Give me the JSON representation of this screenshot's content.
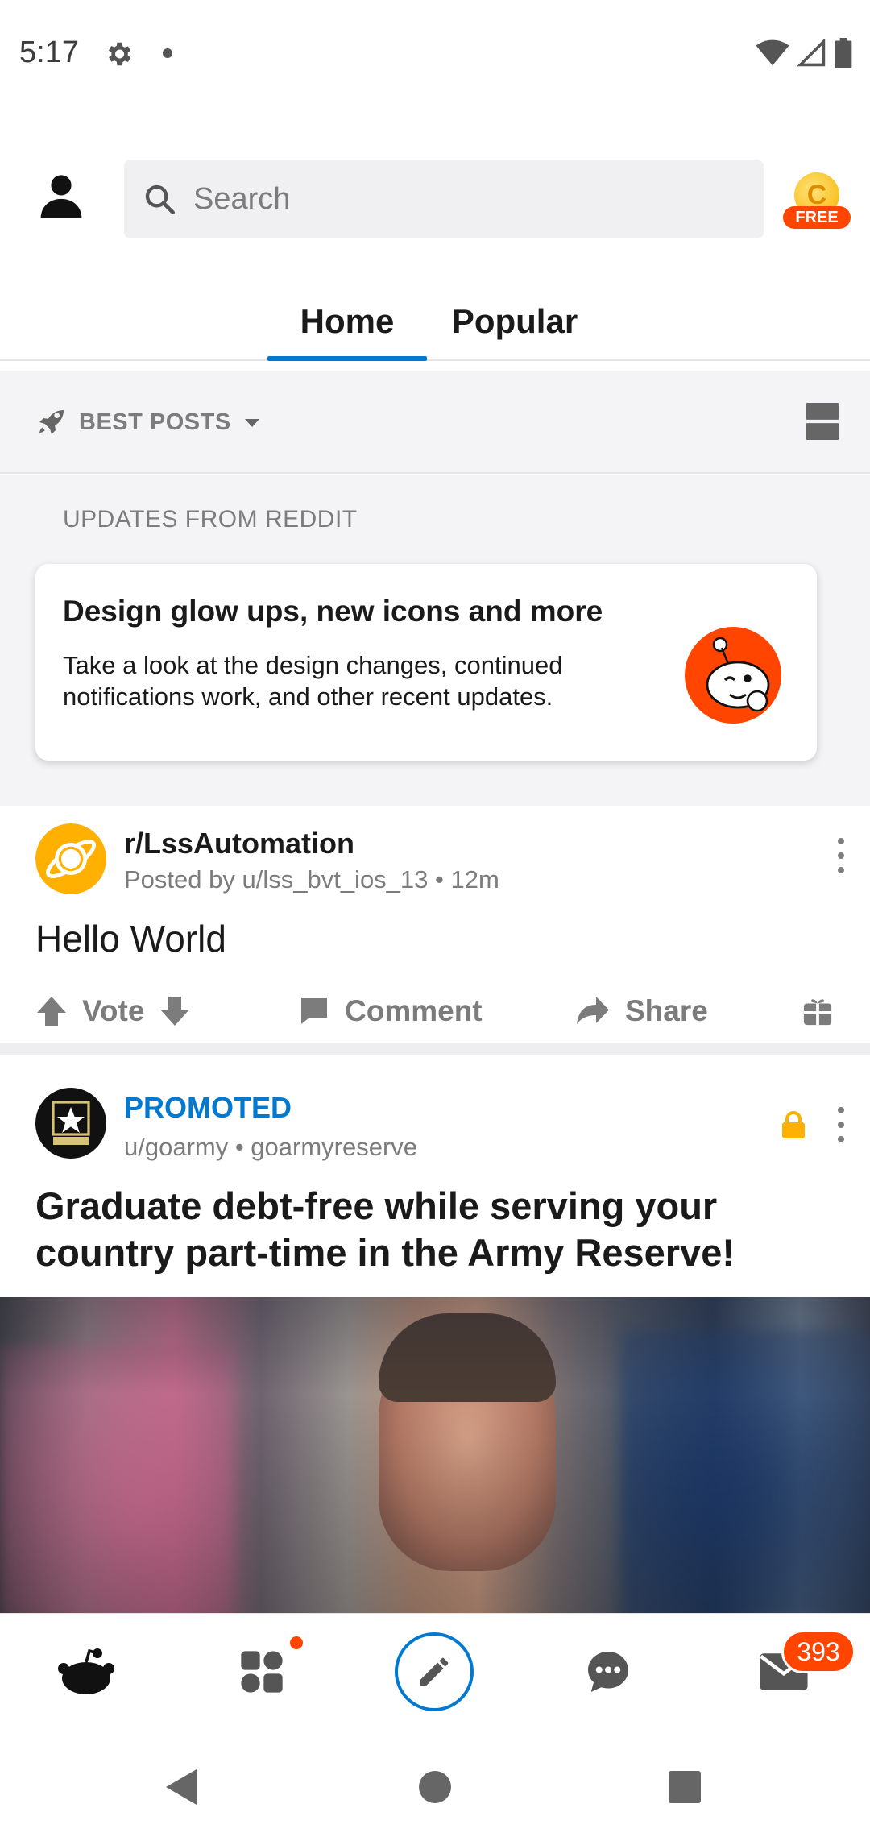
{
  "status_bar": {
    "time": "5:17",
    "icons": [
      "gear-icon",
      "dot-icon",
      "wifi-icon",
      "cell-signal-icon",
      "battery-icon"
    ]
  },
  "header": {
    "search_placeholder": "Search",
    "coin_label": "C",
    "coin_badge": "FREE",
    "tabs": [
      {
        "label": "Home",
        "selected": true
      },
      {
        "label": "Popular",
        "selected": false
      }
    ]
  },
  "sort": {
    "label": "BEST POSTS"
  },
  "updates": {
    "heading": "UPDATES FROM REDDIT",
    "card_title": "Design glow ups, new icons and more",
    "card_body": "Take a look at the design changes, continued notifications work, and other recent updates."
  },
  "posts": [
    {
      "subreddit": "r/LssAutomation",
      "meta": "Posted by u/lss_bvt_ios_13 • 12m",
      "title": "Hello World",
      "vote_label": "Vote",
      "comment_label": "Comment",
      "share_label": "Share"
    },
    {
      "promoted_label": "PROMOTED",
      "meta": "u/goarmy • goarmyreserve",
      "title": "Graduate debt-free while serving your country part-time in the Army Reserve!"
    }
  ],
  "bottom_nav": {
    "items": [
      "home-icon",
      "communities-icon",
      "create-post-icon",
      "chat-icon",
      "inbox-icon"
    ],
    "inbox_count": "393"
  },
  "colors": {
    "accent": "#0079d3",
    "orangered": "#ff4500",
    "muted_text": "#7c7c7c",
    "feed_bg": "#f4f4f6"
  }
}
